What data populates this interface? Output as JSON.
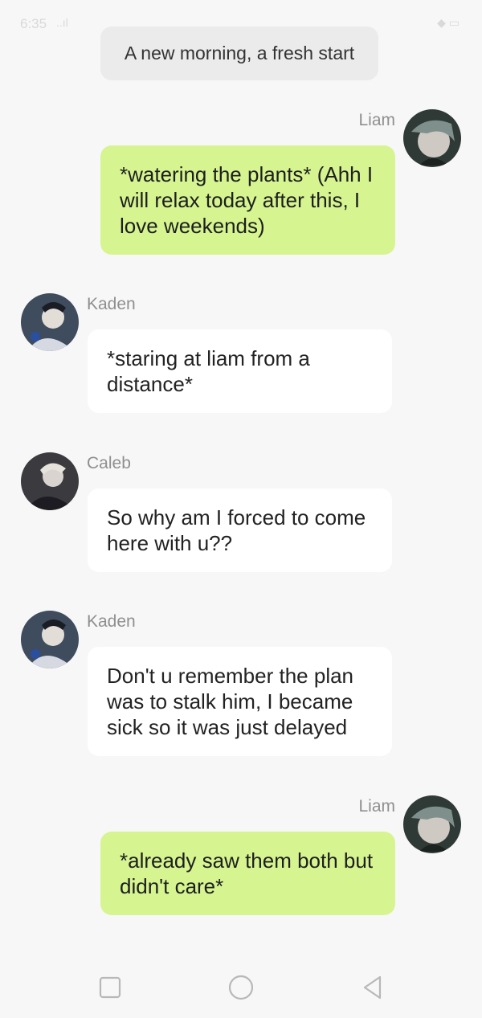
{
  "status_bar": {
    "time": "6:35",
    "signal": "..ıl",
    "right_icons": "◆ ▭"
  },
  "system_message": "A new morning, a fresh start",
  "messages": [
    {
      "sender": "Liam",
      "side": "right",
      "text": "*watering the plants* (Ahh I will relax today after this, I love weekends)",
      "avatar": "avatar-liam"
    },
    {
      "sender": "Kaden",
      "side": "left",
      "text": "*staring at liam from a distance*",
      "avatar": "avatar-kaden"
    },
    {
      "sender": "Caleb",
      "side": "left",
      "text": "So why am I forced to come here with u??",
      "avatar": "avatar-caleb"
    },
    {
      "sender": "Kaden",
      "side": "left",
      "text": "Don't u remember the plan was to stalk him, I became sick so it was just delayed",
      "avatar": "avatar-kaden"
    },
    {
      "sender": "Liam",
      "side": "right",
      "text": "*already saw them both but didn't care*",
      "avatar": "avatar-liam"
    }
  ],
  "colors": {
    "user_bubble": "#d6f591",
    "other_bubble": "#ffffff",
    "background": "#f7f7f7"
  },
  "navbar": {
    "icons": [
      "square-recents-icon",
      "circle-home-icon",
      "triangle-back-icon"
    ]
  }
}
